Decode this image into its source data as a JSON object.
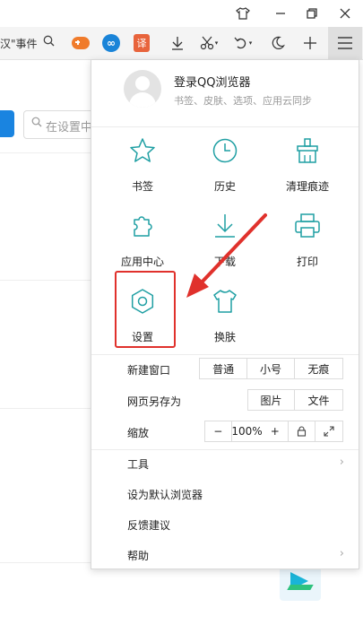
{
  "titlebar": {
    "pin_icon": "shirt-icon",
    "minimize_icon": "minimize-icon",
    "restore_icon": "restore-icon",
    "close_icon": "close-icon"
  },
  "toolbar": {
    "address_text": "汉\"事件",
    "tools": [
      "game-icon",
      "infinity-icon",
      "translate-icon",
      "download-icon",
      "scissors-icon",
      "undo-icon",
      "moon-icon",
      "plus-icon",
      "menu-icon"
    ],
    "translate_glyph": "译"
  },
  "page": {
    "search_placeholder": "在设置中"
  },
  "menu": {
    "login_title": "登录QQ浏览器",
    "login_subtitle": "书签、皮肤、选项、应用云同步",
    "grid": [
      {
        "label": "书签",
        "icon": "star-icon"
      },
      {
        "label": "历史",
        "icon": "clock-icon"
      },
      {
        "label": "清理痕迹",
        "icon": "broom-icon"
      },
      {
        "label": "应用中心",
        "icon": "puzzle-icon"
      },
      {
        "label": "下载",
        "icon": "download-icon"
      },
      {
        "label": "打印",
        "icon": "printer-icon"
      },
      {
        "label": "设置",
        "icon": "gear-icon"
      },
      {
        "label": "换肤",
        "icon": "shirt-icon"
      }
    ],
    "new_window": {
      "label": "新建窗口",
      "options": [
        "普通",
        "小号",
        "无痕"
      ]
    },
    "save_page": {
      "label": "网页另存为",
      "options": [
        "图片",
        "文件"
      ]
    },
    "zoom": {
      "label": "缩放",
      "minus": "−",
      "value": "100%",
      "plus": "+"
    },
    "tools_label": "工具",
    "default_browser": "设为默认浏览器",
    "feedback": "反馈建议",
    "help": "帮助"
  },
  "colors": {
    "icon_teal": "#1f9fa3",
    "highlight_red": "#e0312c",
    "arrow_red": "#e0312c",
    "accent_blue": "#1a84e0"
  }
}
